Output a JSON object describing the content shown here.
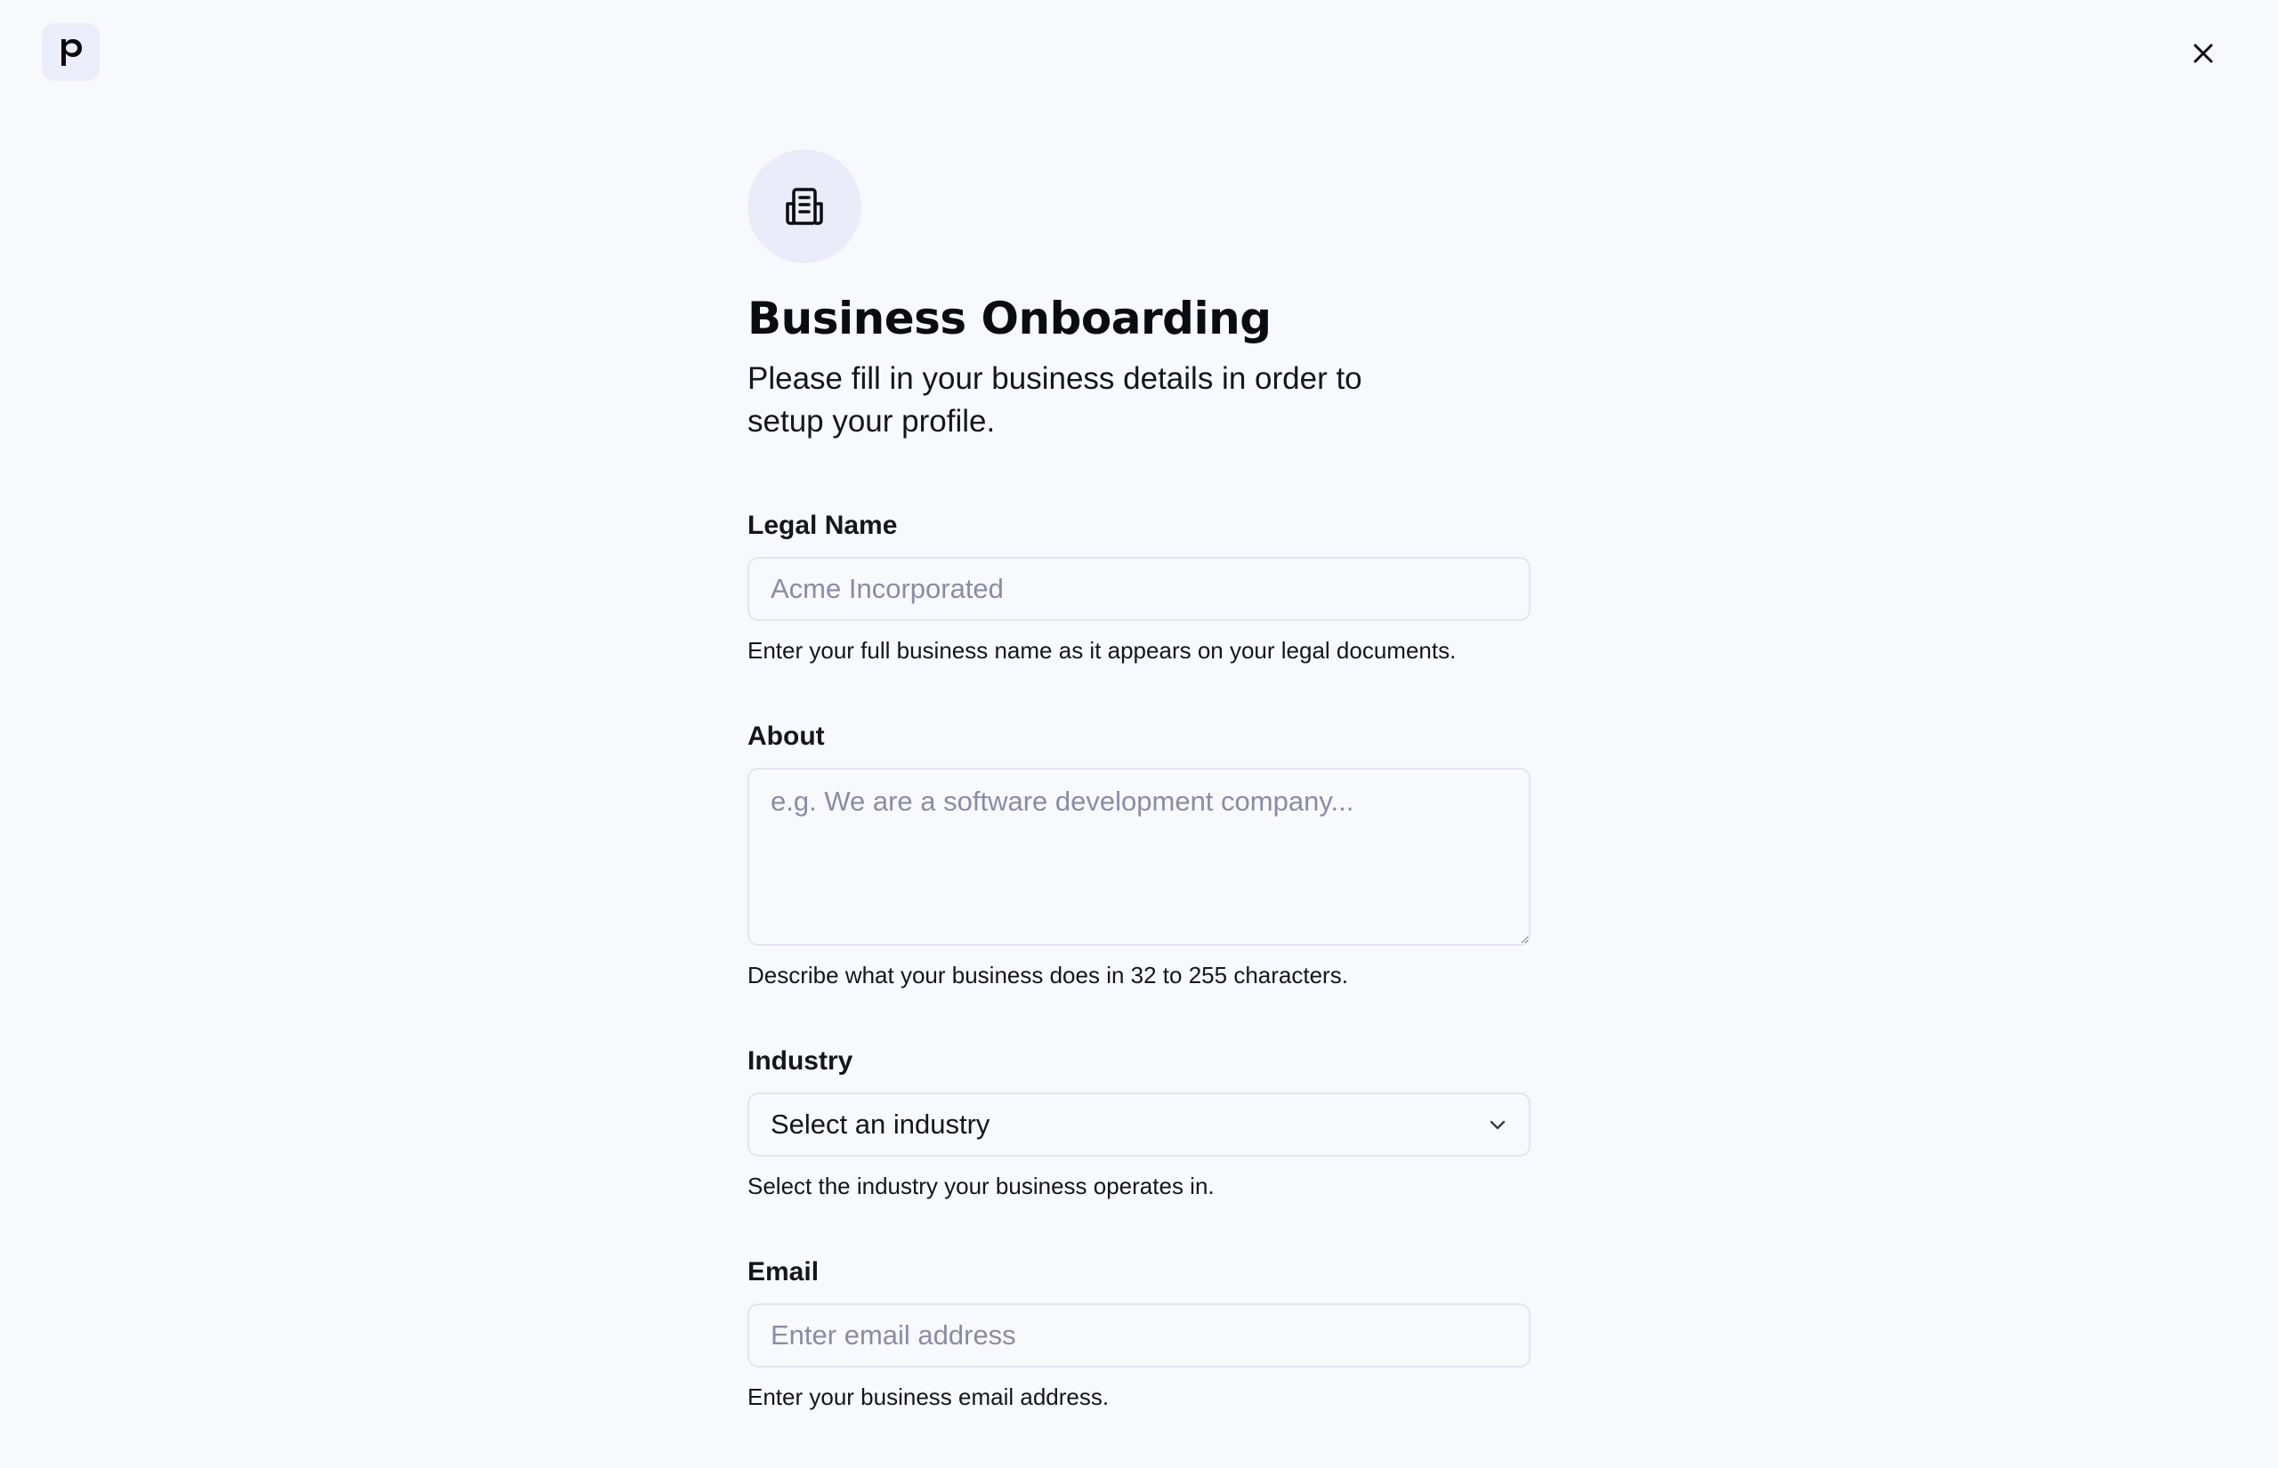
{
  "header": {
    "logo_icon": "brand-p-logo-icon",
    "close_icon": "close-icon"
  },
  "hero": {
    "icon": "building-icon",
    "title": "Business Onboarding",
    "subtitle": "Please fill in your business details in order to setup your profile."
  },
  "form": {
    "legal_name": {
      "label": "Legal Name",
      "value": "",
      "placeholder": "Acme Incorporated",
      "hint": "Enter your full business name as it appears on your legal documents."
    },
    "about": {
      "label": "About",
      "value": "",
      "placeholder": "e.g. We are a software development company...",
      "hint": "Describe what your business does in 32 to 255 characters."
    },
    "industry": {
      "label": "Industry",
      "selected": "Select an industry",
      "hint": "Select the industry your business operates in."
    },
    "email": {
      "label": "Email",
      "value": "",
      "placeholder": "Enter email address",
      "hint": "Enter your business email address."
    }
  },
  "colors": {
    "background": "#f8f9fd",
    "icon_circle": "#ebecfa",
    "input_border": "#e3e5ef",
    "placeholder": "#8a8ca6",
    "text": "#0b0b12"
  }
}
